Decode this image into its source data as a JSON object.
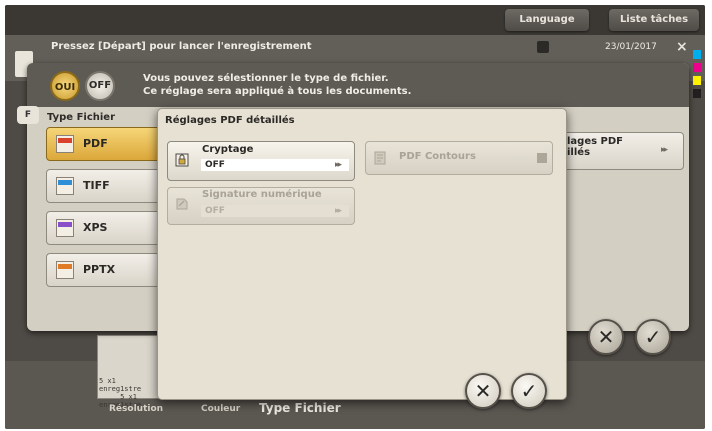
{
  "header": {
    "language_label": "Language",
    "job_list_label": "Liste tâches"
  },
  "status": {
    "message": "Pressez [Départ] pour lancer l'enregistrement",
    "datetime": "23/01/2017"
  },
  "file_settings": {
    "on_label": "OUI",
    "off_label": "OFF",
    "info_line1": "Vous pouvez sélestionner le type de fichier.",
    "info_line2": "Ce réglage sera appliqué à tous les documents.",
    "side_tab_label": "F",
    "type_heading": "Type Fichier",
    "types": [
      {
        "label": "PDF",
        "selected": true,
        "badge_color": "#d9422b"
      },
      {
        "label": "TIFF",
        "selected": false,
        "badge_color": "#2f8fd6"
      },
      {
        "label": "XPS",
        "selected": false,
        "badge_color": "#8a4fc8"
      },
      {
        "label": "PPTX",
        "selected": false,
        "badge_color": "#e07a25"
      }
    ],
    "pdf_detail_label": "lages PDF\nillés"
  },
  "dialog": {
    "title": "Réglages PDF détaillés",
    "encryption": {
      "label": "Cryptage",
      "value": "OFF"
    },
    "digital_signature": {
      "label": "Signature numérique",
      "value": "OFF",
      "enabled": false
    },
    "pdf_outlines": {
      "label": "PDF Contours",
      "enabled": false
    }
  },
  "bottom": {
    "thumb_text": "5 x1\nenreg1stre\n     5 x1\nenreg1stre",
    "resolution_label": "Résolution",
    "color_label": "Couleur",
    "type_label": "Type Fichier"
  },
  "colors": {
    "toner": [
      "#00aeef",
      "#ec008c",
      "#fff200",
      "#231f20"
    ]
  },
  "icons": {
    "cancel": "✕",
    "ok": "✓"
  }
}
